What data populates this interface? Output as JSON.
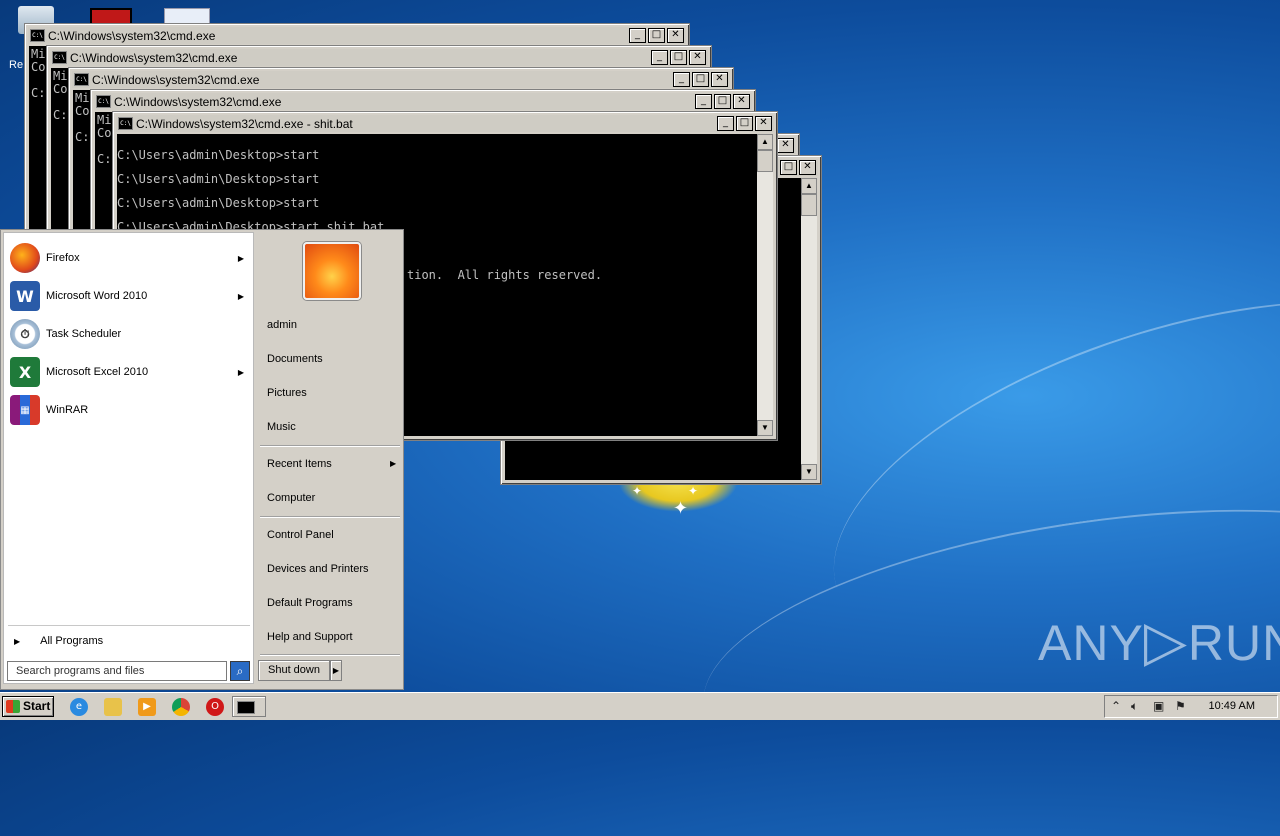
{
  "desktop": {
    "icon_label_partial": "Re",
    "watermark_left": "ANY",
    "watermark_right": "RUN"
  },
  "cmd_windows": [
    {
      "title": "C:\\Windows\\system32\\cmd.exe",
      "side": "Mi\nCo\n\nC:"
    },
    {
      "title": "C:\\Windows\\system32\\cmd.exe",
      "side": "Mi\nCo\n\nC:"
    },
    {
      "title": "C:\\Windows\\system32\\cmd.exe",
      "side": "Mi\nCo\n\nC:"
    },
    {
      "title": "C:\\Windows\\system32\\cmd.exe",
      "side": "Mi\nCo\n\nC:"
    }
  ],
  "front_window": {
    "title": "C:\\Windows\\system32\\cmd.exe - shit.bat",
    "lines": [
      "C:\\Users\\admin\\Desktop>start",
      "C:\\Users\\admin\\Desktop>start",
      "C:\\Users\\admin\\Desktop>start",
      "C:\\Users\\admin\\Desktop>start shit.bat"
    ],
    "copyright_partial": "tion.  All rights reserved."
  },
  "start_menu": {
    "programs": [
      {
        "label": "Firefox",
        "icon": "firefox-icon",
        "submenu": true
      },
      {
        "label": "Microsoft Word 2010",
        "icon": "word-icon",
        "submenu": true
      },
      {
        "label": "Task Scheduler",
        "icon": "task-scheduler-icon",
        "submenu": false
      },
      {
        "label": "Microsoft Excel 2010",
        "icon": "excel-icon",
        "submenu": true
      },
      {
        "label": "WinRAR",
        "icon": "winrar-icon",
        "submenu": false
      }
    ],
    "all_programs": "All Programs",
    "search_placeholder": "Search programs and files",
    "right_links": {
      "admin": "admin",
      "documents": "Documents",
      "pictures": "Pictures",
      "music": "Music",
      "recent_items": "Recent Items",
      "computer": "Computer",
      "control_panel": "Control Panel",
      "devices": "Devices and Printers",
      "default_programs": "Default Programs",
      "help": "Help and Support"
    },
    "shutdown_label": "Shut down"
  },
  "taskbar": {
    "start_label": "Start",
    "clock": "10:49 AM"
  }
}
